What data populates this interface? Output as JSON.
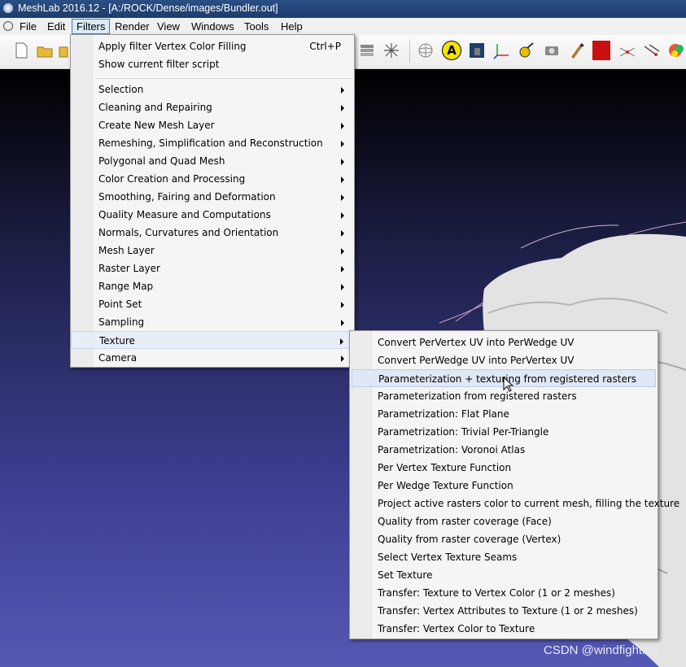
{
  "window": {
    "title": "MeshLab 2016.12 - [A:/ROCK/Dense/images/Bundler.out]"
  },
  "menubar": {
    "items": [
      "File",
      "Edit",
      "Filters",
      "Render",
      "View",
      "Windows",
      "Tools",
      "Help"
    ],
    "active": "Filters"
  },
  "filters_menu": {
    "top": [
      {
        "label": "Apply filter Vertex Color Filling",
        "shortcut": "Ctrl+P"
      },
      {
        "label": "Show current filter script",
        "shortcut": ""
      }
    ],
    "submenus": [
      "Selection",
      "Cleaning and Repairing",
      "Create New Mesh Layer",
      "Remeshing, Simplification and Reconstruction",
      "Polygonal and Quad Mesh",
      "Color Creation and Processing",
      "Smoothing, Fairing and Deformation",
      "Quality Measure and Computations",
      "Normals, Curvatures and Orientation",
      "Mesh Layer",
      "Raster Layer",
      "Range Map",
      "Point Set",
      "Sampling",
      "Texture",
      "Camera"
    ],
    "active_submenu": "Texture"
  },
  "texture_menu": {
    "items": [
      "Convert PerVertex UV into PerWedge UV",
      "Convert PerWedge UV into PerVertex UV",
      "Parameterization + texturing from registered rasters",
      "Parameterization from registered rasters",
      "Parametrization: Flat Plane",
      "Parametrization: Trivial Per-Triangle",
      "Parametrization: Voronoi Atlas",
      "Per Vertex Texture Function",
      "Per Wedge Texture Function",
      "Project active rasters color to current mesh, filling the texture",
      "Quality from raster coverage (Face)",
      "Quality from raster coverage (Vertex)",
      "Select Vertex Texture Seams",
      "Set Texture",
      "Transfer: Texture to Vertex Color (1 or 2 meshes)",
      "Transfer: Vertex Attributes to Texture (1 or 2 meshes)",
      "Transfer: Vertex Color to Texture"
    ],
    "hovered": "Parameterization + texturing from registered rasters"
  },
  "toolbar": {
    "annotation_label": "A"
  },
  "watermark": "CSDN @windfighting",
  "colors": {
    "titlebar": "#2a4f86",
    "menu_highlight": "#dfe8f5",
    "viewport_bottom": "#5558b4"
  }
}
